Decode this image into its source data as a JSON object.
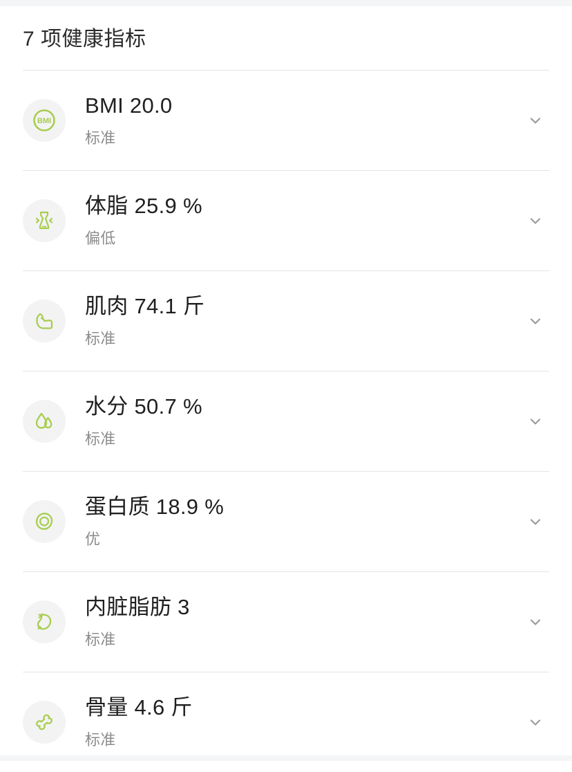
{
  "header": {
    "title": "7 项健康指标"
  },
  "colors": {
    "accent_green": "#a8cd4f",
    "icon_bg": "#f3f3f4",
    "divider": "#e3e4e6",
    "title_text": "#1f1f1f",
    "status_text": "#8c8c8c",
    "chevron": "#9b9b9b",
    "page_bg": "#ffffff",
    "edge_band": "#f4f5f7"
  },
  "metrics": [
    {
      "icon": "bmi-circle-icon",
      "icon_label": "BMI",
      "title": "BMI 20.0",
      "name": "BMI",
      "value": "20.0",
      "unit": "",
      "status": "标准",
      "chevron": "chevron-down-icon"
    },
    {
      "icon": "body-fat-torso-icon",
      "icon_label": "",
      "title": "体脂 25.9 %",
      "name": "体脂",
      "value": "25.9",
      "unit": "%",
      "status": "偏低",
      "chevron": "chevron-down-icon"
    },
    {
      "icon": "muscle-bicep-icon",
      "icon_label": "",
      "title": "肌肉 74.1 斤",
      "name": "肌肉",
      "value": "74.1",
      "unit": "斤",
      "status": "标准",
      "chevron": "chevron-down-icon"
    },
    {
      "icon": "water-droplets-icon",
      "icon_label": "",
      "title": "水分 50.7 %",
      "name": "水分",
      "value": "50.7",
      "unit": "%",
      "status": "标准",
      "chevron": "chevron-down-icon"
    },
    {
      "icon": "protein-egg-icon",
      "icon_label": "",
      "title": "蛋白质 18.9 %",
      "name": "蛋白质",
      "value": "18.9",
      "unit": "%",
      "status": "优",
      "chevron": "chevron-down-icon"
    },
    {
      "icon": "visceral-fat-stomach-icon",
      "icon_label": "",
      "title": "内脏脂肪 3",
      "name": "内脏脂肪",
      "value": "3",
      "unit": "",
      "status": "标准",
      "chevron": "chevron-down-icon"
    },
    {
      "icon": "bone-mass-bone-icon",
      "icon_label": "",
      "title": "骨量 4.6 斤",
      "name": "骨量",
      "value": "4.6",
      "unit": "斤",
      "status": "标准",
      "chevron": "chevron-down-icon"
    }
  ]
}
